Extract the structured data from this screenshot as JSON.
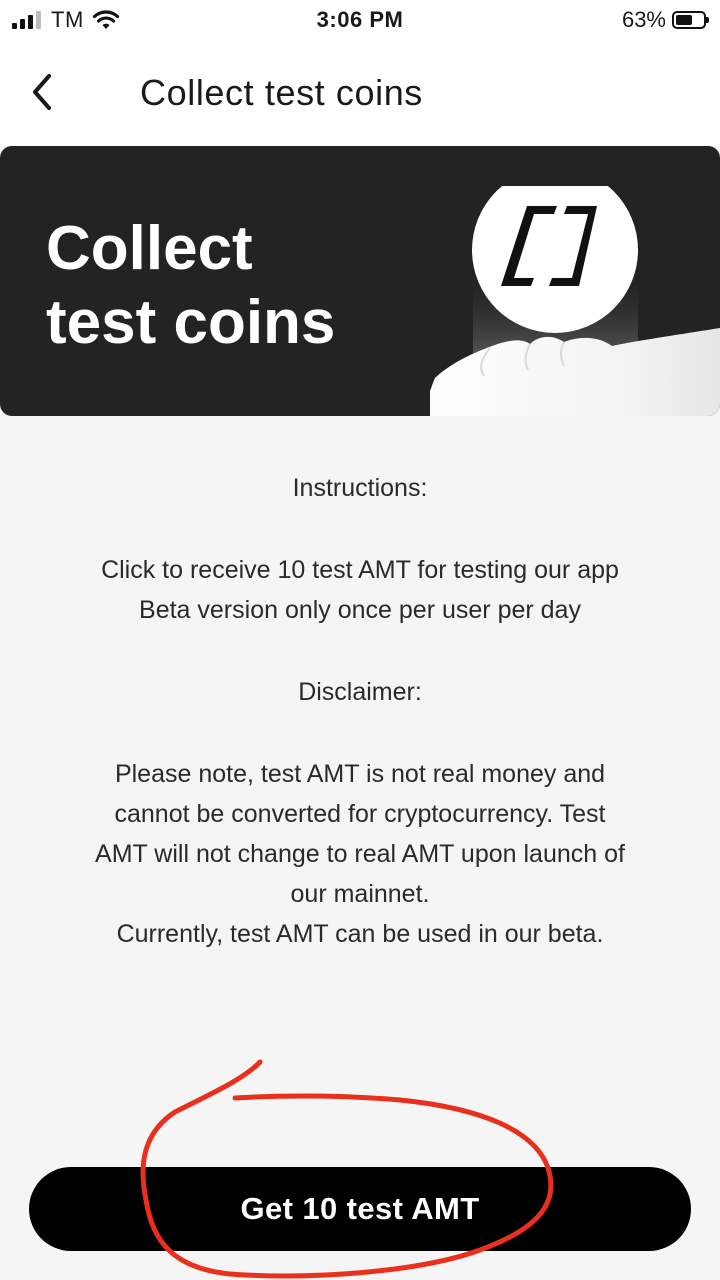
{
  "status_bar": {
    "carrier": "TM",
    "time": "3:06 PM",
    "battery_percent": "63%",
    "battery_level": 0.63,
    "signal_bars": 3
  },
  "header": {
    "title": "Collect test coins",
    "back_icon": "chevron-left-icon"
  },
  "hero": {
    "title": "Collect\ntest coins",
    "art": "hand-holding-coin-icon",
    "background": "#232323"
  },
  "instructions": {
    "heading": "Instructions:",
    "line_1": "Click to receive 10 test AMT for testing our app",
    "line_2": "Beta version only once per user per day"
  },
  "disclaimer": {
    "heading": "Disclaimer:",
    "line_1": "Please note, test AMT is not real money and",
    "line_2": "cannot be converted for cryptocurrency. Test",
    "line_3": "AMT will not change to real AMT upon launch of",
    "line_4": "our mainnet.",
    "line_5": "Currently, test AMT can be used in our beta."
  },
  "cta": {
    "label": "Get 10 test AMT"
  },
  "colors": {
    "accent": "#000000",
    "annotation": "#e8301c"
  }
}
